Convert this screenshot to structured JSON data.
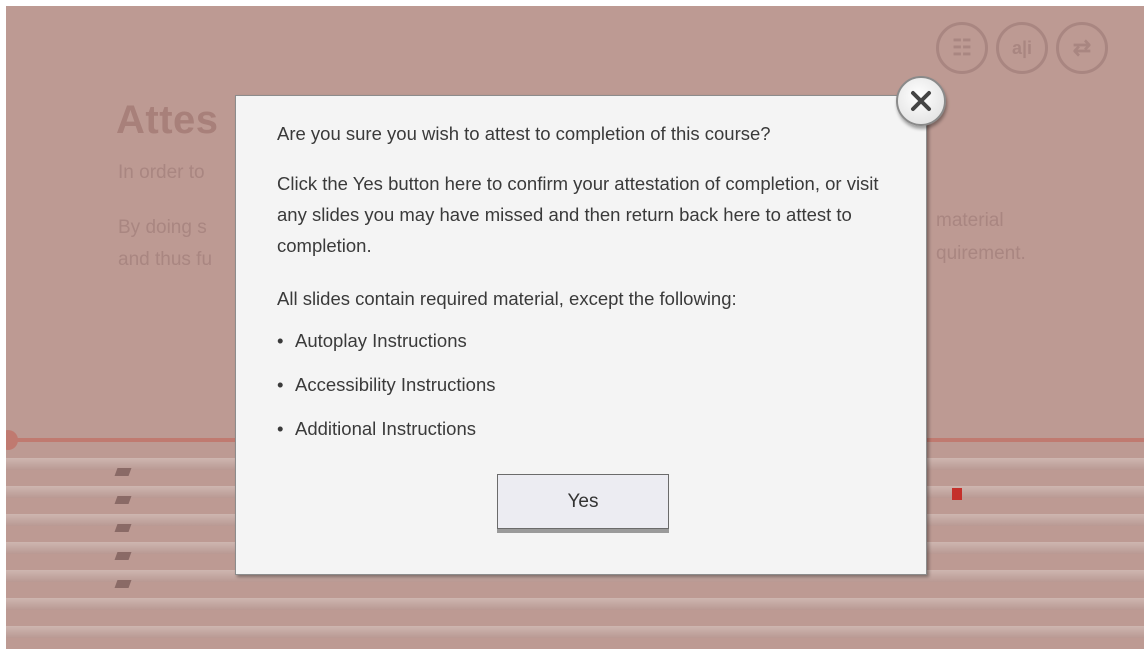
{
  "background": {
    "title": "Attes",
    "subtitle": "In order to",
    "paragraph_line1": "By doing s",
    "paragraph_line2": "and thus fu",
    "right_line1": "material",
    "right_line2": "quirement."
  },
  "top_icons": [
    {
      "name": "transcript-icon",
      "glyph": "☷"
    },
    {
      "name": "accessibility-info-icon",
      "glyph": "a|i"
    },
    {
      "name": "replay-icon",
      "glyph": "⇄"
    }
  ],
  "dialog": {
    "question": "Are you sure you wish to attest to completion of this course?",
    "confirm_text": "Click the Yes button here to confirm your attestation of completion, or visit any slides you may have missed and then return back here to attest to completion.",
    "required_text": "All slides contain required material, except the following:",
    "exceptions": [
      "Autoplay Instructions",
      "Accessibility Instructions",
      "Additional Instructions"
    ],
    "yes_label": "Yes",
    "close_glyph": "X"
  },
  "colors": {
    "overlay": "#bd9a93",
    "dialog_bg": "#f4f4f4",
    "progress": "#c07a70"
  }
}
